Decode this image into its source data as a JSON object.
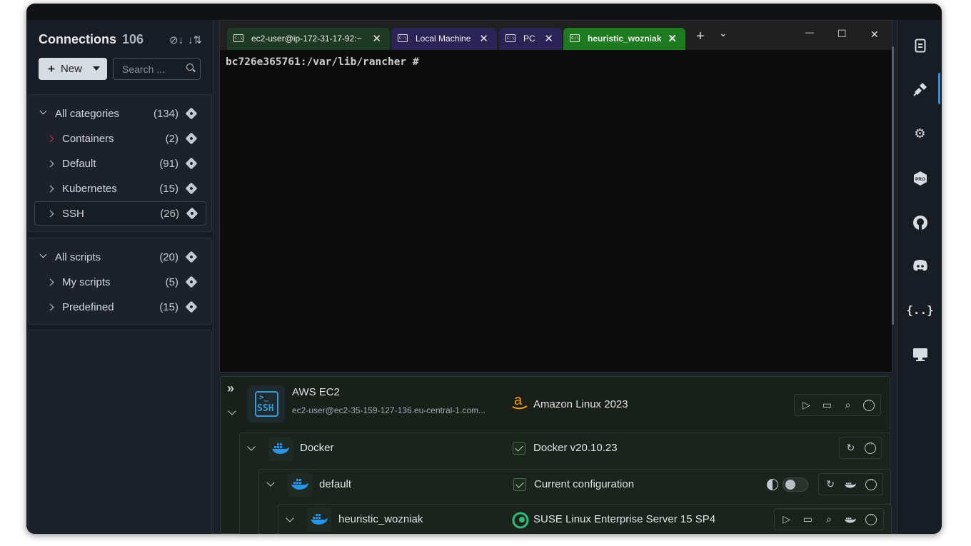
{
  "sidebar": {
    "title": "Connections",
    "count": "106",
    "new_button": "New",
    "search_placeholder": "Search ...",
    "categories": [
      {
        "label": "All categories",
        "count": "(134)"
      },
      {
        "label": "Containers",
        "count": "(2)"
      },
      {
        "label": "Default",
        "count": "(91)"
      },
      {
        "label": "Kubernetes",
        "count": "(15)"
      },
      {
        "label": "SSH",
        "count": "(26)"
      }
    ],
    "scripts": [
      {
        "label": "All scripts",
        "count": "(20)"
      },
      {
        "label": "My scripts",
        "count": "(5)"
      },
      {
        "label": "Predefined",
        "count": "(15)"
      }
    ]
  },
  "terminal": {
    "tabs": [
      {
        "label": "ec2-user@ip-172-31-17-92:~",
        "icon": "C:\\",
        "color": "#1f3a24"
      },
      {
        "label": "Local Machine",
        "icon": "C:\\",
        "color": "#2a2456"
      },
      {
        "label": "PC",
        "icon": "C:\\",
        "color": "#2a2456"
      },
      {
        "label": "heuristic_wozniak",
        "icon": "C:\\",
        "color": "#1e7a1e"
      }
    ],
    "new_tab": "+",
    "dropdown": "⌄",
    "minimize": "—",
    "maximize": "☐",
    "close": "✕",
    "prompt": "bc726e365761:/var/lib/rancher #"
  },
  "tree": {
    "host": {
      "name": "AWS EC2",
      "address": "ec2-user@ec2-35-159-127-136.eu-central-1.com...",
      "os": "Amazon Linux 2023",
      "ssh_label": "SSH",
      "ssh_prompt": ">_"
    },
    "docker": {
      "name": "Docker",
      "detail": "Docker v20.10.23"
    },
    "context": {
      "name": "default",
      "detail": "Current  configuration"
    },
    "container": {
      "name": "heuristic_wozniak",
      "os": "SUSE Linux Enterprise Server 15 SP4"
    }
  },
  "rail": {
    "icons": [
      "file-icon",
      "plug-icon",
      "gears-icon",
      "pro-icon",
      "github-icon",
      "discord-icon",
      "json-icon",
      "monitor-icon"
    ],
    "pro_label": "PRO",
    "json_label": "{..}"
  },
  "colors": {
    "accent": "#3a8fd9",
    "active_tab": "#1e7a1e",
    "docker_blue": "#2496ed",
    "amazon_orange": "#ff9900",
    "suse_green": "#30ba78",
    "chevron_red": "#d23030"
  }
}
